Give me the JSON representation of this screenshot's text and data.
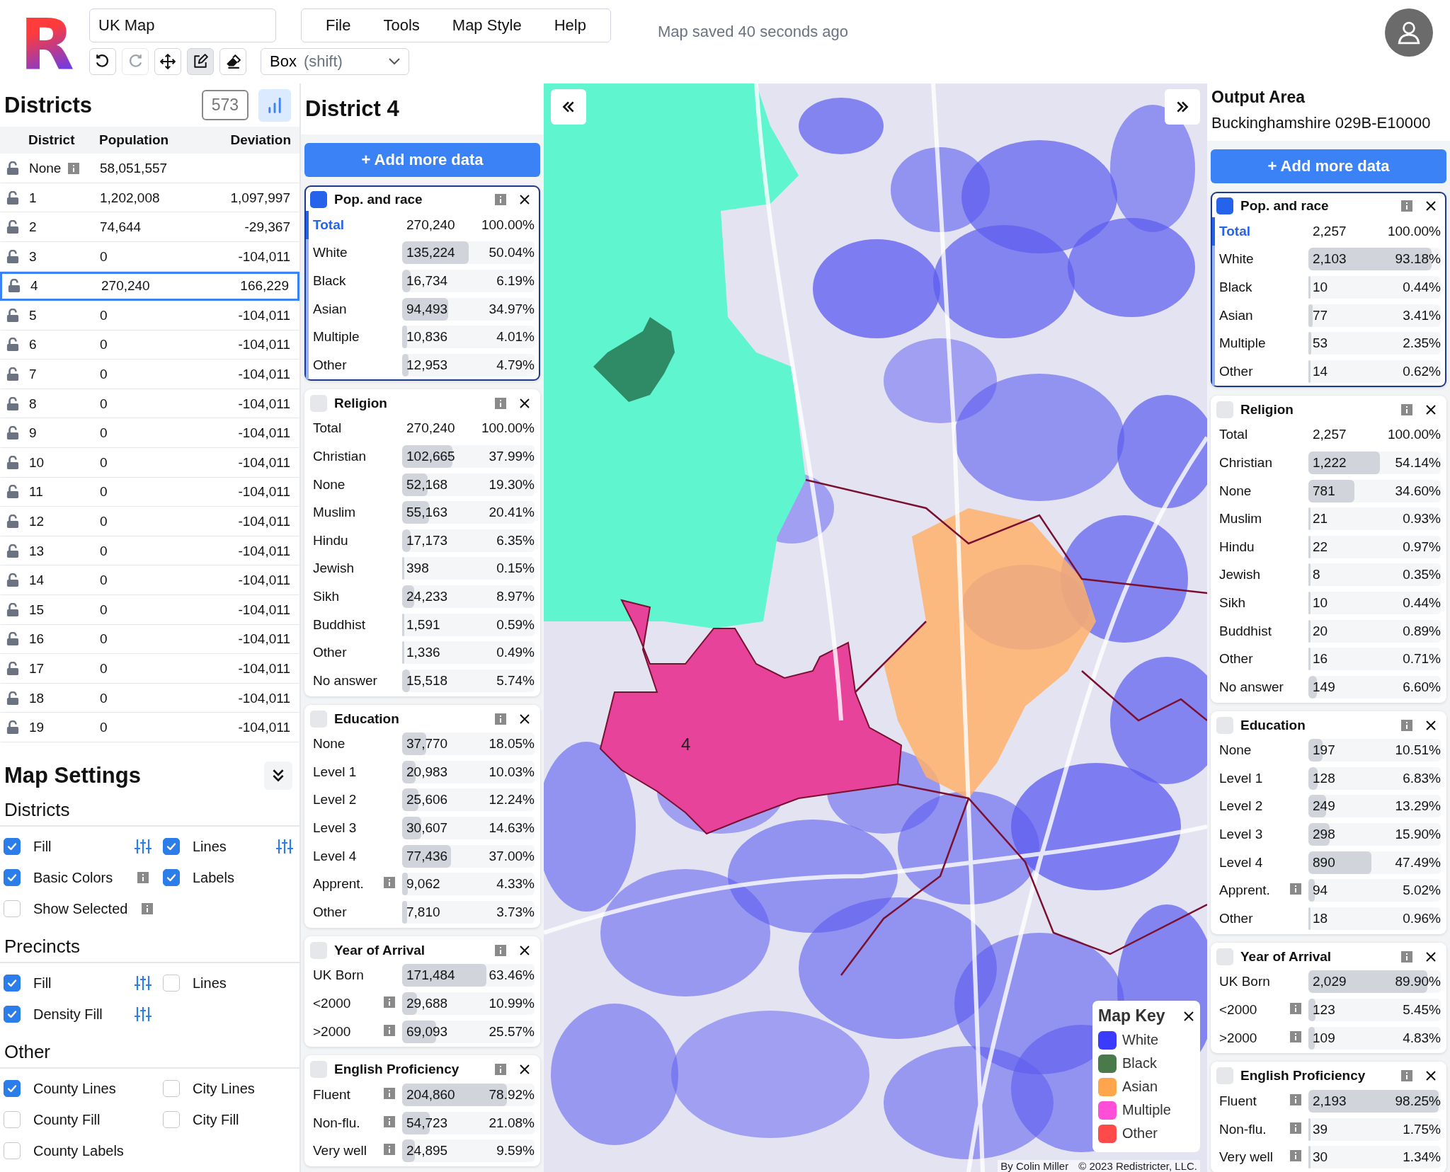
{
  "app": {
    "logo": "R",
    "map_name": "UK Map",
    "menu": [
      "File",
      "Tools",
      "Map Style",
      "Help"
    ],
    "status": "Map saved 40 seconds ago",
    "tools": [
      {
        "kind": "undo",
        "selected": false,
        "disabled": false
      },
      {
        "kind": "redo",
        "selected": false,
        "disabled": true
      },
      {
        "kind": "move",
        "selected": false,
        "disabled": false
      },
      {
        "kind": "edit",
        "selected": true,
        "disabled": false
      },
      {
        "kind": "erase",
        "selected": false,
        "disabled": false
      }
    ],
    "select_mode": {
      "value": "Box",
      "hint": "(shift)"
    }
  },
  "districts": {
    "title": "Districts",
    "count": "573",
    "chart_toggle": {
      "on": true
    },
    "columns": [
      "District",
      "Population",
      "Deviation"
    ],
    "rows": [
      {
        "kind": "unassigned",
        "district": "None",
        "population": "58,051,557",
        "selected": false
      },
      {
        "kind": "district",
        "district": "1",
        "population": "1,202,008",
        "deviation": "1,097,997",
        "selected": false
      },
      {
        "kind": "district",
        "district": "2",
        "population": "74,644",
        "deviation": "-29,367",
        "selected": false
      },
      {
        "kind": "district",
        "district": "3",
        "population": "0",
        "deviation": "-104,011",
        "selected": false
      },
      {
        "kind": "district",
        "district": "4",
        "population": "270,240",
        "deviation": "166,229",
        "selected": true
      },
      {
        "kind": "district",
        "district": "5",
        "population": "0",
        "deviation": "-104,011",
        "selected": false
      },
      {
        "kind": "district",
        "district": "6",
        "population": "0",
        "deviation": "-104,011",
        "selected": false
      },
      {
        "kind": "district",
        "district": "7",
        "population": "0",
        "deviation": "-104,011",
        "selected": false
      },
      {
        "kind": "district",
        "district": "8",
        "population": "0",
        "deviation": "-104,011",
        "selected": false
      },
      {
        "kind": "district",
        "district": "9",
        "population": "0",
        "deviation": "-104,011",
        "selected": false
      },
      {
        "kind": "district",
        "district": "10",
        "population": "0",
        "deviation": "-104,011",
        "selected": false
      },
      {
        "kind": "district",
        "district": "11",
        "population": "0",
        "deviation": "-104,011",
        "selected": false
      },
      {
        "kind": "district",
        "district": "12",
        "population": "0",
        "deviation": "-104,011",
        "selected": false
      },
      {
        "kind": "district",
        "district": "13",
        "population": "0",
        "deviation": "-104,011",
        "selected": false
      },
      {
        "kind": "district",
        "district": "14",
        "population": "0",
        "deviation": "-104,011",
        "selected": false
      },
      {
        "kind": "district",
        "district": "15",
        "population": "0",
        "deviation": "-104,011",
        "selected": false
      },
      {
        "kind": "district",
        "district": "16",
        "population": "0",
        "deviation": "-104,011",
        "selected": false
      },
      {
        "kind": "district",
        "district": "17",
        "population": "0",
        "deviation": "-104,011",
        "selected": false
      },
      {
        "kind": "district",
        "district": "18",
        "population": "0",
        "deviation": "-104,011",
        "selected": false
      },
      {
        "kind": "district",
        "district": "19",
        "population": "0",
        "deviation": "-104,011",
        "selected": false
      }
    ]
  },
  "map_settings": {
    "title": "Map Settings",
    "sections": [
      {
        "title": "Districts",
        "items": [
          {
            "label": "Fill",
            "checked": true,
            "kind": "tune"
          },
          {
            "label": "Lines",
            "checked": true,
            "kind": "tune"
          },
          {
            "label": "Basic Colors",
            "checked": true,
            "kind": "info"
          },
          {
            "label": "Labels",
            "checked": true,
            "kind": "plain"
          },
          {
            "label": "Show Selected",
            "checked": false,
            "kind": "info"
          }
        ]
      },
      {
        "title": "Precincts",
        "items": [
          {
            "label": "Fill",
            "checked": true,
            "kind": "tune"
          },
          {
            "label": "Lines",
            "checked": false,
            "kind": "plain"
          },
          {
            "label": "Density Fill",
            "checked": true,
            "kind": "tune"
          }
        ]
      },
      {
        "title": "Other",
        "items": [
          {
            "label": "County Lines",
            "checked": true,
            "kind": "plain"
          },
          {
            "label": "City Lines",
            "checked": false,
            "kind": "plain"
          },
          {
            "label": "County Fill",
            "checked": false,
            "kind": "plain"
          },
          {
            "label": "City Fill",
            "checked": false,
            "kind": "plain"
          },
          {
            "label": "County Labels",
            "checked": false,
            "kind": "plain"
          }
        ]
      }
    ]
  },
  "district_panel": {
    "title": "District 4",
    "add_button": "+ Add more data",
    "cards": [
      {
        "title": "Pop. and race",
        "selected": true,
        "rows": [
          {
            "kind": "total",
            "label": "Total",
            "value": "270,240",
            "pct": "100.00%"
          },
          {
            "kind": "value",
            "label": "White",
            "value": "135,224",
            "pct": "50.04%",
            "level": 0.5004
          },
          {
            "kind": "value",
            "label": "Black",
            "value": "16,734",
            "pct": "6.19%",
            "level": 0.0619
          },
          {
            "kind": "value",
            "label": "Asian",
            "value": "94,493",
            "pct": "34.97%",
            "level": 0.3497
          },
          {
            "kind": "value",
            "label": "Multiple",
            "value": "10,836",
            "pct": "4.01%",
            "level": 0.0401
          },
          {
            "kind": "value",
            "label": "Other",
            "value": "12,953",
            "pct": "4.79%",
            "level": 0.0479
          }
        ]
      },
      {
        "title": "Religion",
        "selected": false,
        "rows": [
          {
            "kind": "total",
            "label": "Total",
            "value": "270,240",
            "pct": "100.00%"
          },
          {
            "kind": "value",
            "label": "Christian",
            "value": "102,665",
            "pct": "37.99%",
            "level": 0.3799
          },
          {
            "kind": "value",
            "label": "None",
            "value": "52,168",
            "pct": "19.30%",
            "level": 0.193
          },
          {
            "kind": "value",
            "label": "Muslim",
            "value": "55,163",
            "pct": "20.41%",
            "level": 0.2041
          },
          {
            "kind": "value",
            "label": "Hindu",
            "value": "17,173",
            "pct": "6.35%",
            "level": 0.0635
          },
          {
            "kind": "value",
            "label": "Jewish",
            "value": "398",
            "pct": "0.15%",
            "level": 0.0015
          },
          {
            "kind": "value",
            "label": "Sikh",
            "value": "24,233",
            "pct": "8.97%",
            "level": 0.0897
          },
          {
            "kind": "value",
            "label": "Buddhist",
            "value": "1,591",
            "pct": "0.59%",
            "level": 0.0059
          },
          {
            "kind": "value",
            "label": "Other",
            "value": "1,336",
            "pct": "0.49%",
            "level": 0.0049
          },
          {
            "kind": "value",
            "label": "No answer",
            "value": "15,518",
            "pct": "5.74%",
            "level": 0.0574
          }
        ]
      },
      {
        "title": "Education",
        "selected": false,
        "rows": [
          {
            "kind": "value",
            "label": "None",
            "value": "37,770",
            "pct": "18.05%",
            "level": 0.1805
          },
          {
            "kind": "value",
            "label": "Level 1",
            "value": "20,983",
            "pct": "10.03%",
            "level": 0.1003
          },
          {
            "kind": "value",
            "label": "Level 2",
            "value": "25,606",
            "pct": "12.24%",
            "level": 0.1224
          },
          {
            "kind": "value",
            "label": "Level 3",
            "value": "30,607",
            "pct": "14.63%",
            "level": 0.1463
          },
          {
            "kind": "value",
            "label": "Level 4",
            "value": "77,436",
            "pct": "37.00%",
            "level": 0.37
          },
          {
            "kind": "annotated",
            "label": "Apprent.",
            "value": "9,062",
            "pct": "4.33%",
            "level": 0.0433
          },
          {
            "kind": "value",
            "label": "Other",
            "value": "7,810",
            "pct": "3.73%",
            "level": 0.0373
          }
        ]
      },
      {
        "title": "Year of Arrival",
        "selected": false,
        "rows": [
          {
            "kind": "value",
            "label": "UK Born",
            "value": "171,484",
            "pct": "63.46%",
            "level": 0.6346
          },
          {
            "kind": "annotated",
            "label": "<2000",
            "value": "29,688",
            "pct": "10.99%",
            "level": 0.1099
          },
          {
            "kind": "annotated",
            "label": ">2000",
            "value": "69,093",
            "pct": "25.57%",
            "level": 0.2557
          }
        ]
      },
      {
        "title": "English Proficiency",
        "selected": false,
        "rows": [
          {
            "kind": "annotated",
            "label": "Fluent",
            "value": "204,860",
            "pct": "78.92%",
            "level": 0.7892
          },
          {
            "kind": "annotated",
            "label": "Non-flu.",
            "value": "54,723",
            "pct": "21.08%",
            "level": 0.2108
          },
          {
            "kind": "annotated",
            "label": "Very well",
            "value": "24,895",
            "pct": "9.59%",
            "level": 0.0959
          }
        ]
      }
    ]
  },
  "map": {
    "district_label": "4",
    "credit": "By Colin Miller",
    "copyright": "© 2023 Redistricter, LLC.",
    "key": {
      "title": "Map Key",
      "items": [
        {
          "label": "White",
          "color": "#3b3bff"
        },
        {
          "label": "Black",
          "color": "#4a7a4a"
        },
        {
          "label": "Asian",
          "color": "#ffa64d"
        },
        {
          "label": "Multiple",
          "color": "#ff4fd8"
        },
        {
          "label": "Other",
          "color": "#ff4a4a"
        }
      ]
    }
  },
  "area_panel": {
    "title": "Output Area",
    "subtitle": "Buckinghamshire 029B-E10000",
    "add_button": "+ Add more data",
    "cards": [
      {
        "title": "Pop. and race",
        "selected": true,
        "rows": [
          {
            "kind": "total",
            "label": "Total",
            "value": "2,257",
            "pct": "100.00%"
          },
          {
            "kind": "value",
            "label": "White",
            "value": "2,103",
            "pct": "93.18%",
            "level": 0.9318
          },
          {
            "kind": "value",
            "label": "Black",
            "value": "10",
            "pct": "0.44%",
            "level": 0.0044
          },
          {
            "kind": "value",
            "label": "Asian",
            "value": "77",
            "pct": "3.41%",
            "level": 0.0341
          },
          {
            "kind": "value",
            "label": "Multiple",
            "value": "53",
            "pct": "2.35%",
            "level": 0.0235
          },
          {
            "kind": "value",
            "label": "Other",
            "value": "14",
            "pct": "0.62%",
            "level": 0.0062
          }
        ]
      },
      {
        "title": "Religion",
        "selected": false,
        "rows": [
          {
            "kind": "total",
            "label": "Total",
            "value": "2,257",
            "pct": "100.00%"
          },
          {
            "kind": "value",
            "label": "Christian",
            "value": "1,222",
            "pct": "54.14%",
            "level": 0.5414
          },
          {
            "kind": "value",
            "label": "None",
            "value": "781",
            "pct": "34.60%",
            "level": 0.346
          },
          {
            "kind": "value",
            "label": "Muslim",
            "value": "21",
            "pct": "0.93%",
            "level": 0.0093
          },
          {
            "kind": "value",
            "label": "Hindu",
            "value": "22",
            "pct": "0.97%",
            "level": 0.0097
          },
          {
            "kind": "value",
            "label": "Jewish",
            "value": "8",
            "pct": "0.35%",
            "level": 0.0035
          },
          {
            "kind": "value",
            "label": "Sikh",
            "value": "10",
            "pct": "0.44%",
            "level": 0.0044
          },
          {
            "kind": "value",
            "label": "Buddhist",
            "value": "20",
            "pct": "0.89%",
            "level": 0.0089
          },
          {
            "kind": "value",
            "label": "Other",
            "value": "16",
            "pct": "0.71%",
            "level": 0.0071
          },
          {
            "kind": "value",
            "label": "No answer",
            "value": "149",
            "pct": "6.60%",
            "level": 0.066
          }
        ]
      },
      {
        "title": "Education",
        "selected": false,
        "rows": [
          {
            "kind": "value",
            "label": "None",
            "value": "197",
            "pct": "10.51%",
            "level": 0.1051
          },
          {
            "kind": "value",
            "label": "Level 1",
            "value": "128",
            "pct": "6.83%",
            "level": 0.0683
          },
          {
            "kind": "value",
            "label": "Level 2",
            "value": "249",
            "pct": "13.29%",
            "level": 0.1329
          },
          {
            "kind": "value",
            "label": "Level 3",
            "value": "298",
            "pct": "15.90%",
            "level": 0.159
          },
          {
            "kind": "value",
            "label": "Level 4",
            "value": "890",
            "pct": "47.49%",
            "level": 0.4749
          },
          {
            "kind": "annotated",
            "label": "Apprent.",
            "value": "94",
            "pct": "5.02%",
            "level": 0.0502
          },
          {
            "kind": "value",
            "label": "Other",
            "value": "18",
            "pct": "0.96%",
            "level": 0.0096
          }
        ]
      },
      {
        "title": "Year of Arrival",
        "selected": false,
        "rows": [
          {
            "kind": "value",
            "label": "UK Born",
            "value": "2,029",
            "pct": "89.90%",
            "level": 0.899
          },
          {
            "kind": "annotated",
            "label": "<2000",
            "value": "123",
            "pct": "5.45%",
            "level": 0.0545
          },
          {
            "kind": "annotated",
            "label": ">2000",
            "value": "109",
            "pct": "4.83%",
            "level": 0.0483
          }
        ]
      },
      {
        "title": "English Proficiency",
        "selected": false,
        "rows": [
          {
            "kind": "annotated",
            "label": "Fluent",
            "value": "2,193",
            "pct": "98.25%",
            "level": 0.9825
          },
          {
            "kind": "annotated",
            "label": "Non-flu.",
            "value": "39",
            "pct": "1.75%",
            "level": 0.0175
          },
          {
            "kind": "annotated",
            "label": "Very well",
            "value": "30",
            "pct": "1.34%",
            "level": 0.0134
          }
        ]
      }
    ]
  }
}
